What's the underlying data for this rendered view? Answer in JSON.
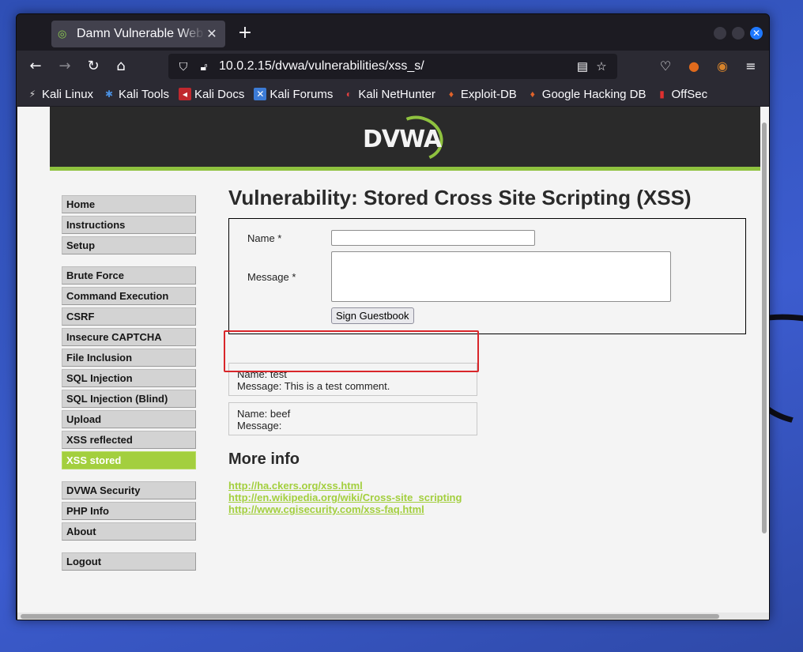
{
  "browser": {
    "tab_title": "Damn Vulnerable Web App",
    "tab_favicon": "dvwa-favicon",
    "url": "10.0.2.15/dvwa/vulnerabilities/xss_s/",
    "bookmarks": [
      {
        "label": "Kali Linux",
        "icon": "kali-dragon-icon"
      },
      {
        "label": "Kali Tools",
        "icon": "kali-tools-icon"
      },
      {
        "label": "Kali Docs",
        "icon": "kali-docs-icon"
      },
      {
        "label": "Kali Forums",
        "icon": "kali-forums-icon"
      },
      {
        "label": "Kali NetHunter",
        "icon": "nethunter-icon"
      },
      {
        "label": "Exploit-DB",
        "icon": "exploit-db-icon"
      },
      {
        "label": "Google Hacking DB",
        "icon": "ghdb-icon"
      },
      {
        "label": "OffSec",
        "icon": "offsec-icon"
      }
    ]
  },
  "dvwa": {
    "logo_text": "DVWA",
    "menu": [
      [
        "Home",
        "Instructions",
        "Setup"
      ],
      [
        "Brute Force",
        "Command Execution",
        "CSRF",
        "Insecure CAPTCHA",
        "File Inclusion",
        "SQL Injection",
        "SQL Injection (Blind)",
        "Upload",
        "XSS reflected",
        "XSS stored"
      ],
      [
        "DVWA Security",
        "PHP Info",
        "About"
      ],
      [
        "Logout"
      ]
    ],
    "active_menu": "XSS stored",
    "page_title": "Vulnerability: Stored Cross Site Scripting (XSS)",
    "form": {
      "name_label": "Name *",
      "name_value": "",
      "message_label": "Message *",
      "message_value": "",
      "submit_label": "Sign Guestbook"
    },
    "guestbook": [
      {
        "name": "Name: test",
        "message": "Message: This is a test comment."
      },
      {
        "name": "Name: beef",
        "message": "Message:"
      }
    ],
    "more_info_title": "More info",
    "links": [
      "http://ha.ckers.org/xss.html",
      "http://en.wikipedia.org/wiki/Cross-site_scripting",
      "http://www.cgisecurity.com/xss-faq.html"
    ]
  },
  "colors": {
    "accent_green": "#8fc23f",
    "link_green": "#a3cf3e",
    "highlight_red": "#d9262a"
  }
}
